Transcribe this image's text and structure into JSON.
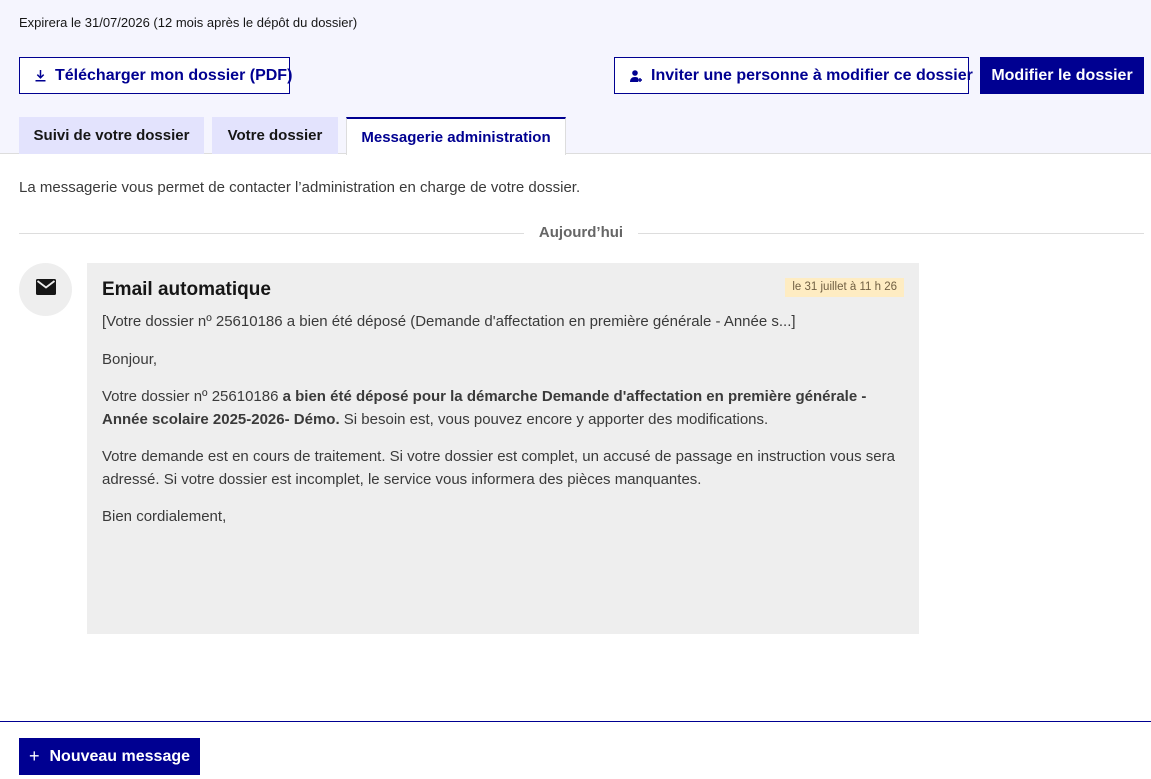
{
  "header": {
    "expiry_text": "Expirera le 31/07/2026 (12 mois après le dépôt du dossier)"
  },
  "actions": {
    "download_label": "Télécharger mon dossier (PDF)",
    "invite_label": "Inviter une personne à modifier ce dossier",
    "modify_label": "Modifier le dossier"
  },
  "tabs": [
    {
      "label": "Suivi de votre dossier",
      "active": false
    },
    {
      "label": "Votre dossier",
      "active": false
    },
    {
      "label": "Messagerie administration",
      "active": true
    }
  ],
  "messagerie": {
    "intro": "La messagerie vous permet de contacter l’administration en charge de votre dossier.",
    "day_separator": "Aujourd’hui"
  },
  "message": {
    "sender_icon": "mail-icon",
    "title": "Email automatique",
    "date": "le 31 juillet à 11 h 26",
    "subject": "[Votre dossier nº 25610186 a bien été déposé (Demande d'affectation en première générale - Année s...]",
    "greeting": "Bonjour,",
    "para1_start": "Votre dossier nº 25610186 ",
    "para1_bold": "a bien été déposé pour la démarche Demande d'affectation en première générale - Année scolaire 2025-2026- Démo.",
    "para1_end": " Si besoin est, vous pouvez encore y apporter des modifications.",
    "para2": "Votre demande est en cours de traitement. Si votre dossier est complet, un accusé de passage en instruction vous sera adressé. Si votre dossier est incomplet, le service vous informera des pièces manquantes.",
    "closing": "Bien cordialement,"
  },
  "footer": {
    "new_message_label": "Nouveau message",
    "new_message_icon": "plus-icon"
  },
  "colors": {
    "primary": "#000091",
    "top_background": "#f5f5fe",
    "tab_inactive": "#e3e3fd",
    "card_background": "#eeeeee",
    "date_badge": "#feecc2"
  }
}
